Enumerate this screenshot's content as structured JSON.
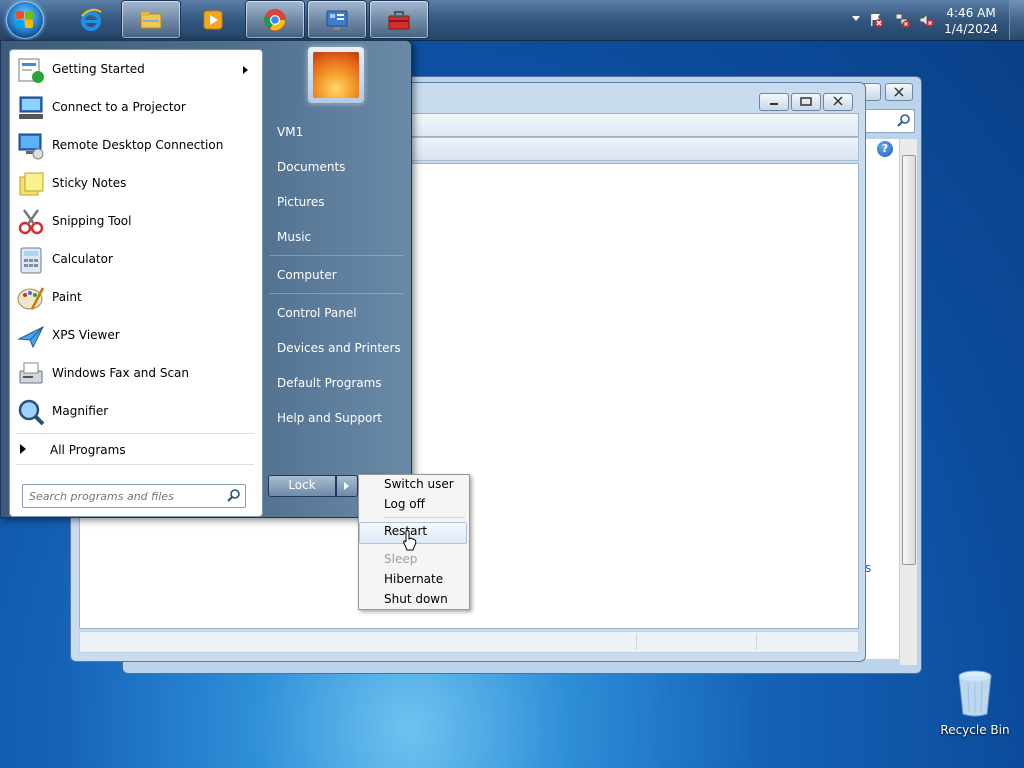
{
  "taskbar": {
    "pinned": [
      {
        "name": "internet-explorer",
        "icon": "ie-icon"
      },
      {
        "name": "windows-explorer",
        "icon": "folder-icon"
      },
      {
        "name": "media-player",
        "icon": "media-player-icon"
      },
      {
        "name": "google-chrome",
        "icon": "chrome-icon"
      },
      {
        "name": "control-panel",
        "icon": "control-panel-icon"
      },
      {
        "name": "toolbox",
        "icon": "toolbox-icon"
      }
    ],
    "clock": {
      "time": "4:46 AM",
      "date": "1/4/2024"
    }
  },
  "start_menu": {
    "programs": [
      {
        "label": "Getting Started",
        "icon": "getting-started-icon",
        "has_submenu": true
      },
      {
        "label": "Connect to a Projector",
        "icon": "projector-icon"
      },
      {
        "label": "Remote Desktop Connection",
        "icon": "remote-desktop-icon"
      },
      {
        "label": "Sticky Notes",
        "icon": "sticky-notes-icon"
      },
      {
        "label": "Snipping Tool",
        "icon": "snipping-tool-icon"
      },
      {
        "label": "Calculator",
        "icon": "calculator-icon"
      },
      {
        "label": "Paint",
        "icon": "paint-icon"
      },
      {
        "label": "XPS Viewer",
        "icon": "xps-viewer-icon"
      },
      {
        "label": "Windows Fax and Scan",
        "icon": "fax-scan-icon"
      },
      {
        "label": "Magnifier",
        "icon": "magnifier-icon"
      }
    ],
    "all_programs_label": "All Programs",
    "search_placeholder": "Search programs and files",
    "right_items": [
      "VM1",
      "Documents",
      "Pictures",
      "Music",
      "Computer",
      "Control Panel",
      "Devices and Printers",
      "Default Programs",
      "Help and Support"
    ],
    "lock_label": "Lock"
  },
  "shutdown_menu": {
    "items": [
      {
        "label": "Switch user",
        "state": "normal"
      },
      {
        "label": "Log off",
        "state": "normal"
      },
      {
        "label": "Restart",
        "state": "hover"
      },
      {
        "label": "Sleep",
        "state": "disabled"
      },
      {
        "label": "Hibernate",
        "state": "normal"
      },
      {
        "label": "Shut down",
        "state": "normal"
      }
    ]
  },
  "background_window": {
    "help_glyph": "?",
    "link_fragment": "s"
  },
  "desktop": {
    "recycle_bin_label": "Recycle Bin"
  }
}
